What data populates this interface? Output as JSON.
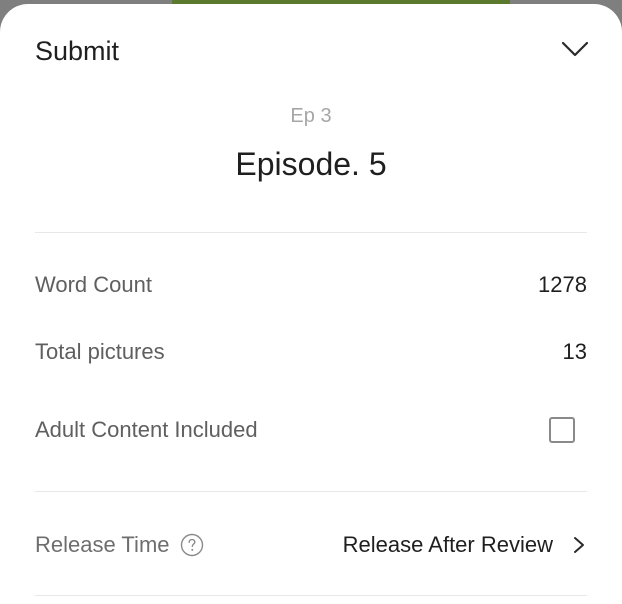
{
  "sheet": {
    "title": "Submit"
  },
  "episode": {
    "subtitle": "Ep 3",
    "title": "Episode. 5"
  },
  "stats": {
    "word_count_label": "Word Count",
    "word_count_value": "1278",
    "total_pictures_label": "Total pictures",
    "total_pictures_value": "13",
    "adult_content_label": "Adult Content Included",
    "adult_content_checked": false
  },
  "release": {
    "label": "Release Time",
    "value": "Release After Review"
  },
  "icons": {
    "collapse": "chevron-down-icon",
    "help": "question-circle-icon",
    "navigate": "chevron-right-icon"
  },
  "colors": {
    "background": "#ffffff",
    "text_primary": "#1f1f1f",
    "text_secondary": "#5f5f5f",
    "text_muted": "#a6a6a6",
    "divider": "#e8e8e8"
  }
}
